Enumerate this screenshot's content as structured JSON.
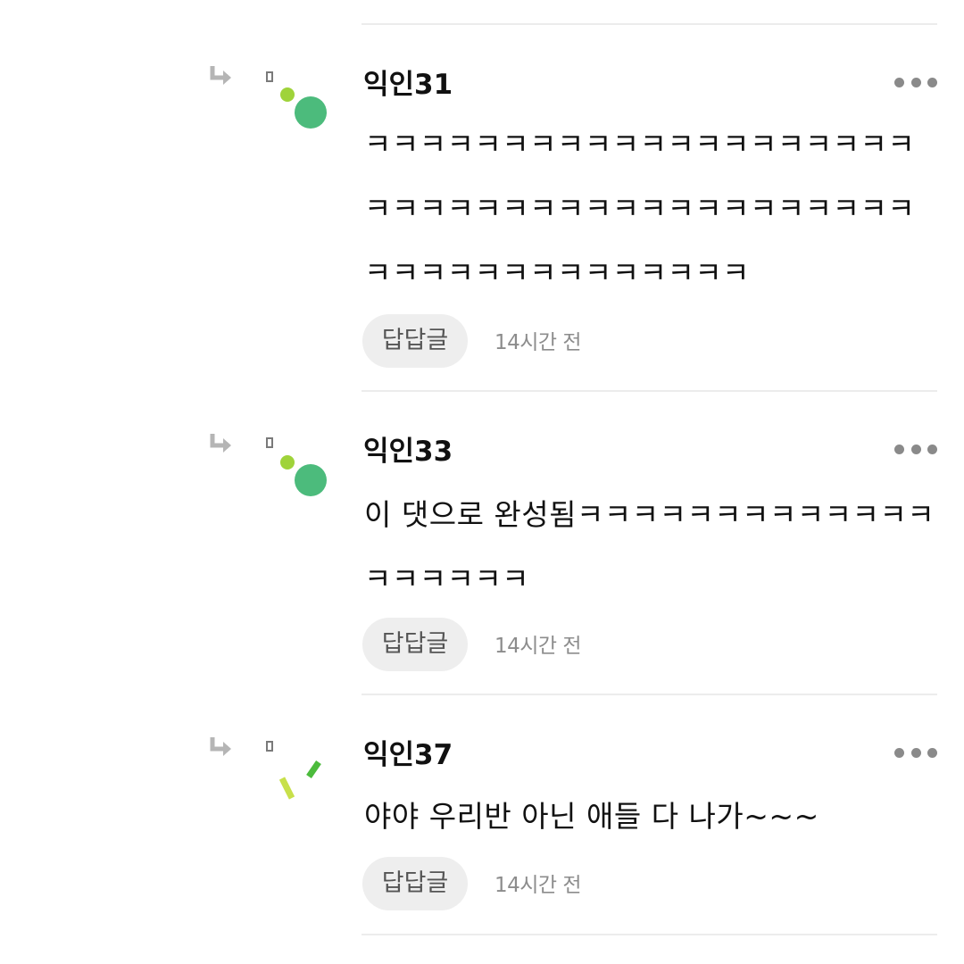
{
  "comments": [
    {
      "author": "익인31",
      "body": "ㅋㅋㅋㅋㅋㅋㅋㅋㅋㅋㅋㅋㅋㅋㅋㅋㅋㅋㅋㅋㅋㅋㅋㅋㅋㅋㅋㅋㅋㅋㅋㅋㅋㅋㅋㅋㅋㅋㅋㅋㅋㅋㅋㅋㅋㅋㅋㅋㅋㅋㅋㅋㅋㅋ",
      "reply_label": "답답글",
      "time": "14시간 전",
      "avatar_icon": "green-dots-avatar-icon"
    },
    {
      "author": "익인33",
      "body": "이 댓으로 완성됨ㅋㅋㅋㅋㅋㅋㅋㅋㅋㅋㅋㅋㅋㅋㅋㅋㅋㅋㅋ",
      "reply_label": "답답글",
      "time": "14시간 전",
      "avatar_icon": "green-dots-avatar-icon"
    },
    {
      "author": "익인37",
      "body": "야야 우리반 아닌 애들 다 나가~~~",
      "reply_label": "답답글",
      "time": "14시간 전",
      "avatar_icon": "green-dashes-avatar-icon"
    }
  ],
  "icons": {
    "reply_arrow": "reply-arrow-icon",
    "more": "more-options-icon"
  },
  "colors": {
    "avatar_green": "#4cbb7c",
    "avatar_lime": "#9fd33a",
    "reply_button_bg": "#eeeeee",
    "time_text": "#8c8c8c"
  }
}
